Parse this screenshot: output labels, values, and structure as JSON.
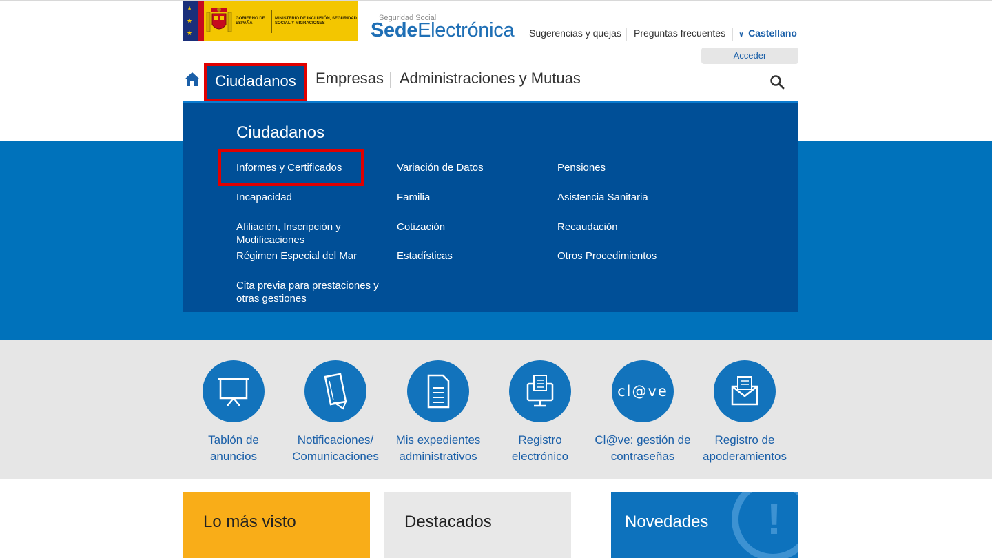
{
  "header": {
    "gov_name": "GOBIERNO DE ESPAÑA",
    "ministry": "MINISTERIO DE INCLUSIÓN, SEGURIDAD SOCIAL Y MIGRACIONES",
    "site_small": "Seguridad Social",
    "site_bold": "Sede",
    "site_rest": "Electrónica",
    "links": [
      "Sugerencias y quejas",
      "Preguntas frecuentes"
    ],
    "language": "Castellano",
    "login": "Acceder"
  },
  "nav": {
    "items": [
      "Ciudadanos",
      "Empresas",
      "Administraciones y Mutuas"
    ],
    "active": "Ciudadanos",
    "home_icon": "home-icon",
    "search_icon": "search-icon"
  },
  "dropdown": {
    "title": "Ciudadanos",
    "items": [
      "Informes y Certificados",
      "Variación de Datos",
      "Pensiones",
      "Incapacidad",
      "Familia",
      "Asistencia Sanitaria",
      "Afiliación, Inscripción y Modificaciones",
      "Cotización",
      "Recaudación",
      "Régimen Especial del Mar",
      "Estadísticas",
      "Otros Procedimientos",
      "Cita previa para prestaciones y otras gestiones"
    ],
    "highlighted": "Informes y Certificados"
  },
  "services": [
    {
      "line1": "Tablón de",
      "line2": "anuncios",
      "icon": "board-icon"
    },
    {
      "line1": "Notificaciones/",
      "line2": "Comunicaciones",
      "icon": "notification-icon"
    },
    {
      "line1": "Mis expedientes",
      "line2": "administrativos",
      "icon": "document-icon"
    },
    {
      "line1": "Registro",
      "line2": "electrónico",
      "icon": "register-icon"
    },
    {
      "line1": "Cl@ve: gestión de",
      "line2": "contraseñas",
      "icon": "clave-icon",
      "icon_text": "cl@ve"
    },
    {
      "line1": "Registro de",
      "line2": "apoderamientos",
      "icon": "envelope-icon"
    }
  ],
  "cards": [
    {
      "title": "Lo más visto",
      "color": "#f9ad18"
    },
    {
      "title": "Destacados",
      "color": "#e8e8e8"
    },
    {
      "title": "Novedades",
      "color": "#0d72bd"
    }
  ],
  "colors": {
    "primary_blue": "#0072bb",
    "dark_blue": "#004f97",
    "highlight_red": "#e00000"
  }
}
